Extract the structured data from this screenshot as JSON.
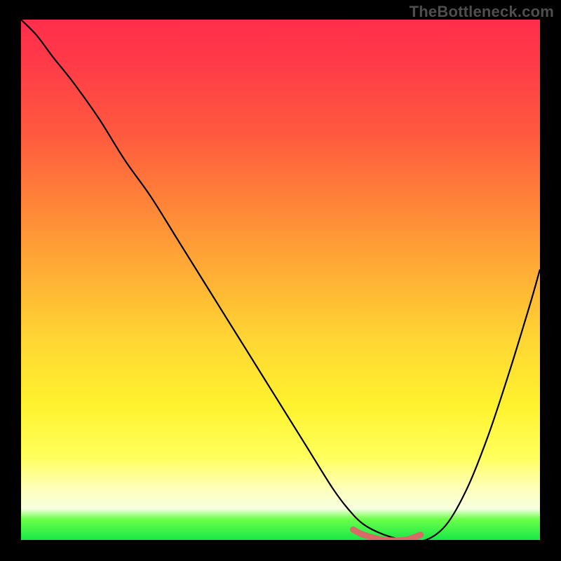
{
  "watermark": "TheBottleneck.com",
  "colors": {
    "background": "#000000",
    "watermark_text": "#4e4e4e",
    "curve": "#000000",
    "trough_highlight": "#d76b66",
    "gradient_top": "#ff2e4c",
    "gradient_bottom": "#18e848"
  },
  "chart_data": {
    "type": "line",
    "title": "",
    "xlabel": "",
    "ylabel": "",
    "xlim": [
      0,
      100
    ],
    "ylim": [
      0,
      100
    ],
    "grid": false,
    "legend": false,
    "annotations": [
      "TheBottleneck.com"
    ],
    "series": [
      {
        "name": "bottleneck-curve",
        "x": [
          0,
          3,
          6,
          10,
          15,
          20,
          25,
          30,
          35,
          40,
          45,
          50,
          55,
          60,
          63,
          66,
          70,
          74,
          78,
          82,
          86,
          90,
          94,
          98,
          100
        ],
        "values": [
          100,
          97,
          93,
          88,
          81,
          73,
          66,
          58,
          50,
          42,
          34,
          26,
          18,
          10,
          6,
          3,
          1,
          0,
          0,
          3,
          10,
          20,
          32,
          45,
          52
        ]
      },
      {
        "name": "optimal-range-highlight",
        "x": [
          64,
          66,
          70,
          74,
          77
        ],
        "values": [
          2,
          1,
          0,
          0,
          1
        ]
      }
    ],
    "background_gradient": {
      "orientation": "vertical",
      "stops": [
        {
          "pos": 0.0,
          "color": "#ff2e4c"
        },
        {
          "pos": 0.22,
          "color": "#ff5a3f"
        },
        {
          "pos": 0.5,
          "color": "#ffb235"
        },
        {
          "pos": 0.74,
          "color": "#fff22e"
        },
        {
          "pos": 0.9,
          "color": "#feffb8"
        },
        {
          "pos": 0.96,
          "color": "#6bff4a"
        },
        {
          "pos": 1.0,
          "color": "#18e848"
        }
      ]
    }
  }
}
